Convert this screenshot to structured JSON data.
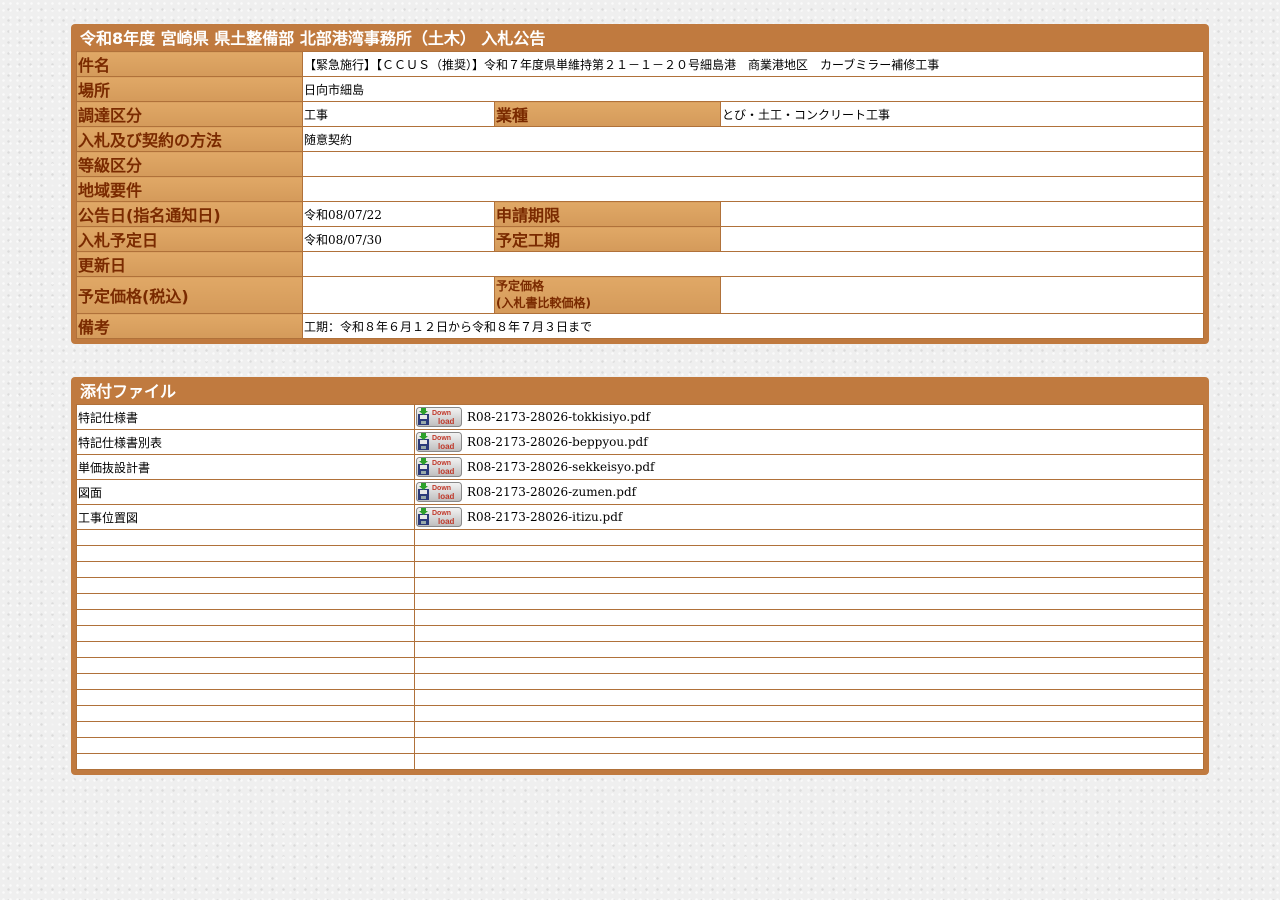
{
  "notice": {
    "title": "令和8年度 宮崎県 県土整備部 北部港湾事務所（土木） 入札公告",
    "fields": {
      "subject_label": "件名",
      "subject_value": "【緊急施行】【ＣＣＵＳ（推奨）】令和７年度県単維持第２１－１－２０号細島港　商業港地区　カーブミラー補修工事",
      "location_label": "場所",
      "location_value": "日向市細島",
      "category_label": "調達区分",
      "category_value": "工事",
      "industry_label": "業種",
      "industry_value": "とび・土工・コンクリート工事",
      "method_label": "入札及び契約の方法",
      "method_value": "随意契約",
      "grade_label": "等級区分",
      "grade_value": "",
      "region_label": "地域要件",
      "region_value": "",
      "announce_label": "公告日(指名通知日)",
      "announce_value": "令和08/07/22",
      "apply_label": "申請期限",
      "apply_value": "",
      "bid_date_label": "入札予定日",
      "bid_date_value": "令和08/07/30",
      "period_label": "予定工期",
      "period_value": "",
      "updated_label": "更新日",
      "updated_value": "",
      "price_label": "予定価格(税込)",
      "price_value": "",
      "price2_label_line1": "予定価格",
      "price2_label_line2": "(入札書比較価格)",
      "price2_value": "",
      "notes_label": "備考",
      "notes_value": "工期：令和８年６月１２日から令和８年７月３日まで"
    }
  },
  "attachments": {
    "title": "添付ファイル",
    "icon": "download-icon",
    "files": [
      {
        "name": "特記仕様書",
        "file": "R08-2173-28026-tokkisiyo.pdf"
      },
      {
        "name": "特記仕様書別表",
        "file": "R08-2173-28026-beppyou.pdf"
      },
      {
        "name": "単価抜設計書",
        "file": "R08-2173-28026-sekkeisyo.pdf"
      },
      {
        "name": "図面",
        "file": "R08-2173-28026-zumen.pdf"
      },
      {
        "name": "工事位置図",
        "file": "R08-2173-28026-itizu.pdf"
      }
    ],
    "empty_rows": 15
  },
  "colors": {
    "panel": "#c07a3f",
    "header_cell": "#d9a060",
    "header_text": "#7a2a00"
  }
}
